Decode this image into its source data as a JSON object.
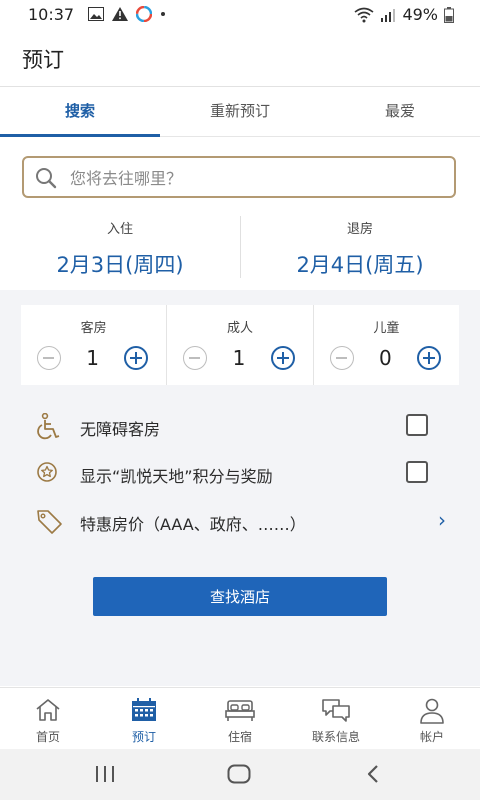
{
  "status_bar": {
    "time": "10:37",
    "battery": "49%"
  },
  "header": {
    "title": "预订"
  },
  "tabs": [
    {
      "label": "搜索",
      "active": true
    },
    {
      "label": "重新预订",
      "active": false
    },
    {
      "label": "最爱",
      "active": false
    }
  ],
  "search": {
    "placeholder": "您将去往哪里？",
    "value": ""
  },
  "dates": {
    "checkin_label": "入住",
    "checkin_value": "2月3日(周四)",
    "checkout_label": "退房",
    "checkout_value": "2月4日(周五)"
  },
  "guests": [
    {
      "label": "客房",
      "value": "1"
    },
    {
      "label": "成人",
      "value": "1"
    },
    {
      "label": "儿童",
      "value": "0"
    }
  ],
  "options": {
    "accessible": {
      "label": "无障碍客房",
      "checked": false,
      "icon": "wheelchair-icon"
    },
    "points": {
      "label": "显示“凯悦天地”积分与奖励",
      "checked": false,
      "icon": "star-badge-icon"
    },
    "special_rates": {
      "label": "特惠房价（AAA、政府、……）",
      "icon": "tag-icon"
    }
  },
  "find_button": {
    "label": "查找酒店"
  },
  "bottom_nav": [
    {
      "label": "首页",
      "icon": "home-icon",
      "active": false
    },
    {
      "label": "预订",
      "icon": "calendar-icon",
      "active": true
    },
    {
      "label": "住宿",
      "icon": "bed-icon",
      "active": false
    },
    {
      "label": "联系信息",
      "icon": "chat-icon",
      "active": false
    },
    {
      "label": "帐户",
      "icon": "person-icon",
      "active": false
    }
  ],
  "colors": {
    "accent": "#1f5fa6",
    "search_border": "#b39a73",
    "icon_gold": "#9c7a45"
  }
}
